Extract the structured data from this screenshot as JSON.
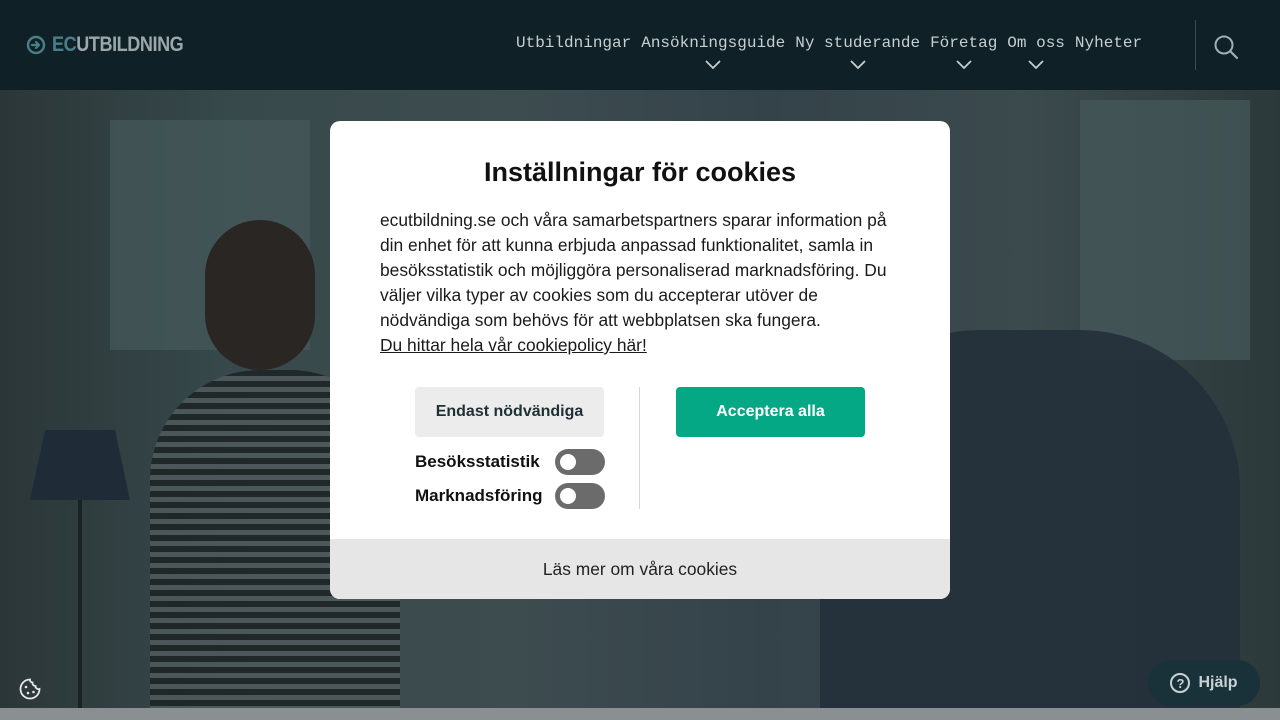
{
  "header": {
    "logo_prefix": "EC",
    "logo_suffix": "UTBILDNING",
    "nav": [
      {
        "label": "Utbildningar",
        "has_dropdown": false
      },
      {
        "label": "Ansökningsguide",
        "has_dropdown": true
      },
      {
        "label": "Ny studerande",
        "has_dropdown": true
      },
      {
        "label": "Företag",
        "has_dropdown": true
      },
      {
        "label": "Om oss",
        "has_dropdown": true
      },
      {
        "label": "Nyheter",
        "has_dropdown": false
      }
    ],
    "search_icon": "search-icon"
  },
  "modal": {
    "title": "Inställningar för cookies",
    "body": "ecutbildning.se och våra samarbetspartners sparar information på din enhet för att kunna erbjuda anpassad funktionalitet, samla in besöksstatistik och möjliggöra personaliserad marknadsföring. Du väljer vilka typer av cookies som du accepterar utöver de nödvändiga som behövs för att webbplatsen ska fungera.",
    "policy_link": "Du hittar hela vår cookiepolicy här!",
    "necessary_button": "Endast nödvändiga",
    "accept_button": "Acceptera alla",
    "toggles": [
      {
        "label": "Besöksstatistik",
        "on": false
      },
      {
        "label": "Marknadsföring",
        "on": false
      }
    ],
    "footer_link": "Läs mer om våra cookies"
  },
  "widgets": {
    "cookie_icon": "cookie-icon",
    "help_label": "Hjälp",
    "help_icon_glyph": "?"
  },
  "colors": {
    "header_bg": "#0f2126",
    "accent_green": "#05a884",
    "toggle_off": "#6b6b6b"
  }
}
